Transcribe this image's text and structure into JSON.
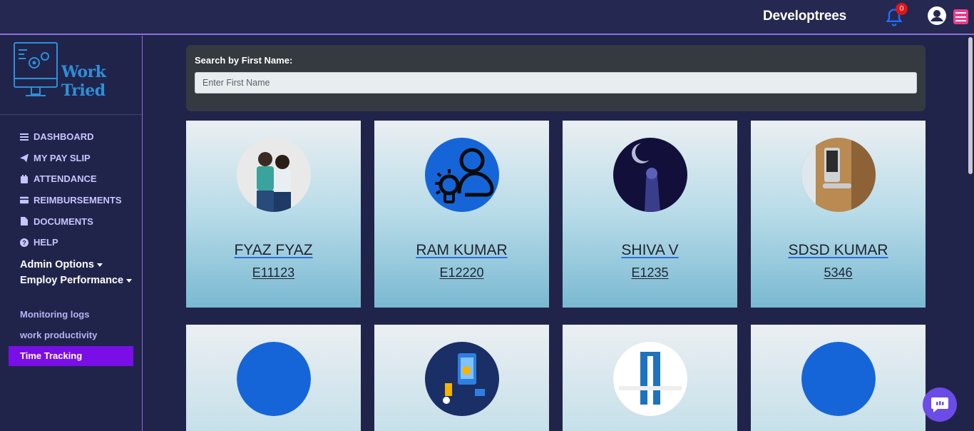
{
  "header": {
    "brand": "Developtrees",
    "notification_count": "0"
  },
  "logo": {
    "text": "Work Tried"
  },
  "sidebar": {
    "items": [
      {
        "label": "DASHBOARD",
        "icon": "list-icon"
      },
      {
        "label": "MY PAY SLIP",
        "icon": "paper-plane-icon"
      },
      {
        "label": "ATTENDANCE",
        "icon": "calendar-icon"
      },
      {
        "label": "REIMBURSEMENTS",
        "icon": "credit-card-icon"
      },
      {
        "label": "DOCUMENTS",
        "icon": "file-icon"
      },
      {
        "label": "HELP",
        "icon": "question-circle-icon"
      }
    ],
    "admin_options": "Admin Options",
    "employ_performance": "Employ Performance",
    "sub_items": [
      "Monitoring logs",
      "work productivity",
      "Time Tracking"
    ]
  },
  "search": {
    "label": "Search by First Name:",
    "placeholder": "Enter First Name",
    "value": ""
  },
  "employees": [
    {
      "name": "FYAZ  FYAZ",
      "id": "E11123",
      "avatar": "two-children-photo"
    },
    {
      "name": "RAM  KUMAR",
      "id": "E12220",
      "avatar": "user-idea-icon"
    },
    {
      "name": "SHIVA  V",
      "id": "E1235",
      "avatar": "dark-figure-photo"
    },
    {
      "name": "SDSD  KUMAR",
      "id": "5346",
      "avatar": "door-lock-photo"
    },
    {
      "name": "",
      "id": "",
      "avatar": "blue-circle"
    },
    {
      "name": "",
      "id": "",
      "avatar": "tech-illustration"
    },
    {
      "name": "",
      "id": "",
      "avatar": "worktried-logo"
    },
    {
      "name": "",
      "id": "",
      "avatar": "blue-circle"
    }
  ],
  "colors": {
    "accent": "#7a0ee6",
    "menu": "#ec3b8a",
    "chat": "#6b4ce6",
    "avatar_blue": "#1565d8"
  }
}
